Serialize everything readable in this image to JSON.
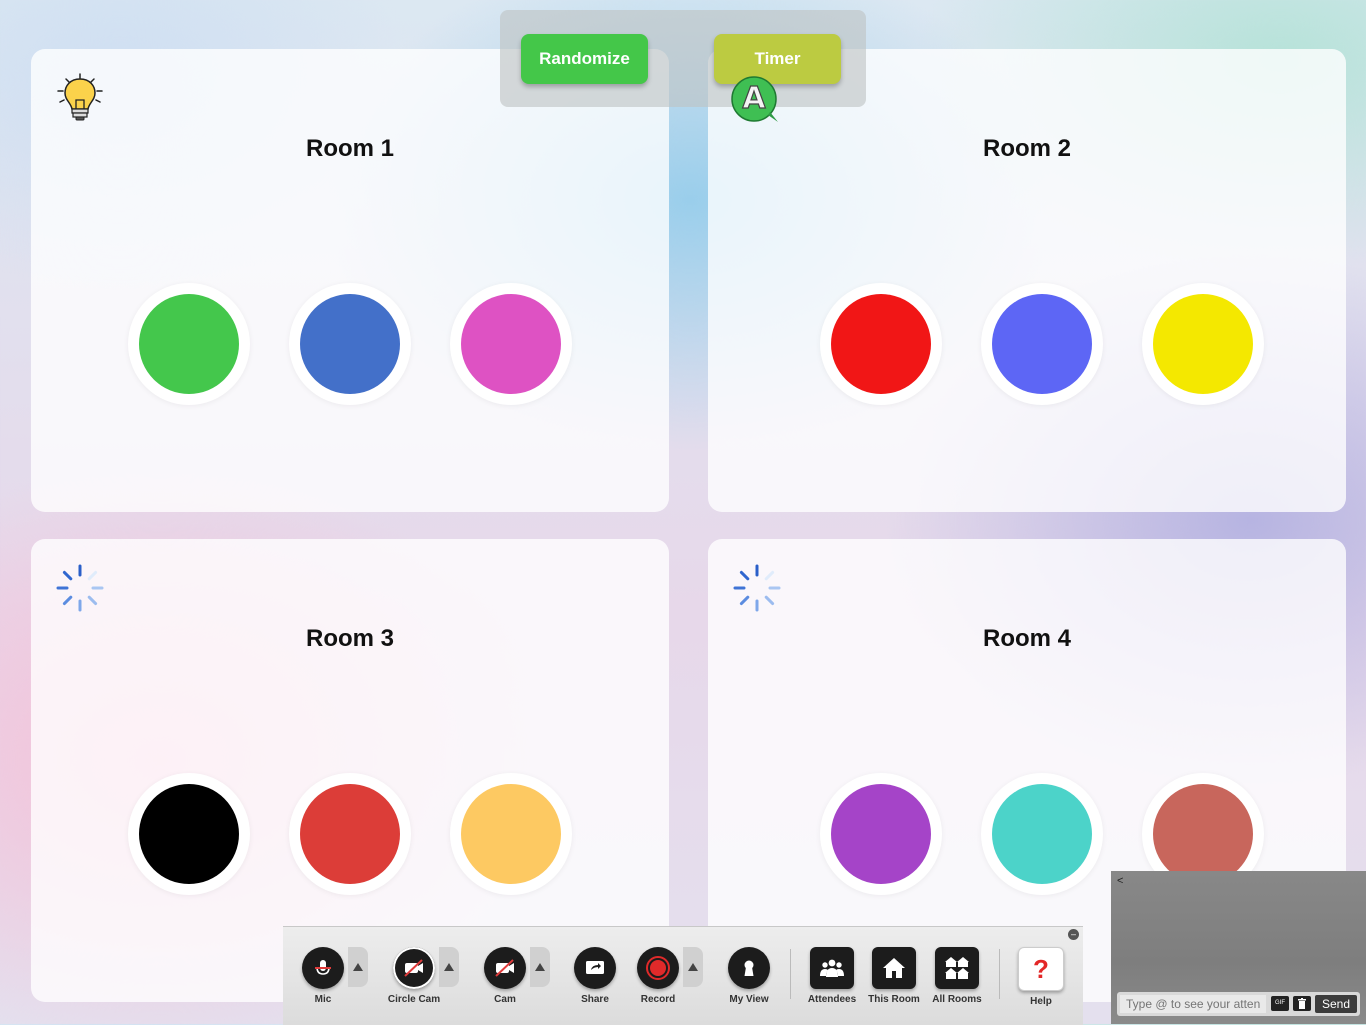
{
  "top_controls": {
    "randomize_label": "Randomize",
    "timer_label": "Timer",
    "avatar_letter": "A"
  },
  "rooms": [
    {
      "title": "Room 1",
      "icon": "lightbulb-icon",
      "dots": [
        "#44c74c",
        "#4370c9",
        "#de52c3"
      ]
    },
    {
      "title": "Room 2",
      "icon": "avatar-a-icon",
      "dots": [
        "#f11616",
        "#5d66f5",
        "#f4e800"
      ]
    },
    {
      "title": "Room 3",
      "icon": "loading-spinner-icon",
      "dots": [
        "#000000",
        "#dc3d38",
        "#fdc962"
      ]
    },
    {
      "title": "Room 4",
      "icon": "loading-spinner-icon",
      "dots": [
        "#a544c8",
        "#4cd3c9",
        "#c8665c"
      ]
    }
  ],
  "toolbar": {
    "mic_label": "Mic",
    "circle_cam_label": "Circle Cam",
    "cam_label": "Cam",
    "share_label": "Share",
    "record_label": "Record",
    "my_view_label": "My View",
    "attendees_label": "Attendees",
    "this_room_label": "This Room",
    "all_rooms_label": "All Rooms",
    "help_label": "Help",
    "help_glyph": "?"
  },
  "chat": {
    "back_glyph": "<",
    "input_placeholder": "Type @ to see your attendees",
    "gif_label": "GIF",
    "send_label": "Send"
  }
}
